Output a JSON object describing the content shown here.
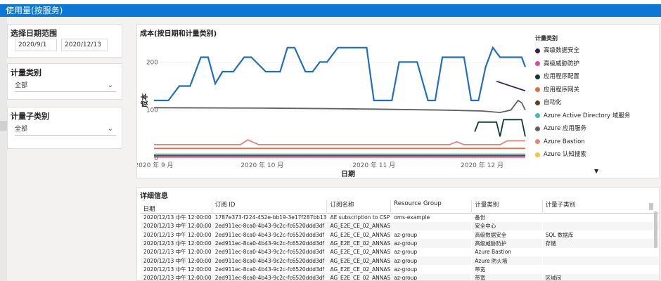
{
  "header": {
    "title": "使用量(按服务)"
  },
  "date_slicer": {
    "title": "选择日期范围",
    "start": "2020/9/1",
    "end": "2020/12/13"
  },
  "meter_category_slicer": {
    "title": "计量类别",
    "value": "全部"
  },
  "meter_subcategory_slicer": {
    "title": "计量子类别",
    "value": "全部"
  },
  "chart": {
    "title": "成本(按日期和计量类别)",
    "ylabel": "成本",
    "xlabel": "日期",
    "yticks": [
      "0",
      "100",
      "200"
    ],
    "xticks": [
      "2020 年 9 月",
      "2020 年 10 月",
      "2020 年 11 月",
      "2020 年 12 月"
    ],
    "legend_title": "计量类别",
    "legend_more_icon": "triangle-down-icon",
    "legend": [
      {
        "name": "高级数据安全",
        "color": "#3b1d4a"
      },
      {
        "name": "高级威胁防护",
        "color": "#e044a7"
      },
      {
        "name": "应用程序配置",
        "color": "#0e3a2f"
      },
      {
        "name": "应用程序网关",
        "color": "#e66c37"
      },
      {
        "name": "自动化",
        "color": "#6b3a1f"
      },
      {
        "name": "Azure Active Directory 域服务",
        "color": "#3cc0b5"
      },
      {
        "name": "Azure 应用服务",
        "color": "#616161"
      },
      {
        "name": "Azure Bastion",
        "color": "#e8817b"
      },
      {
        "name": "Azure 认知搜索",
        "color": "#f5c242"
      }
    ]
  },
  "chart_data": {
    "type": "line",
    "title": "成本(按日期和计量类别)",
    "xlabel": "日期",
    "ylabel": "成本",
    "x_range": [
      "2020-09-01",
      "2020-12-13"
    ],
    "ylim": [
      0,
      240
    ],
    "legend_position": "right",
    "series": [
      {
        "name": "Azure 认知搜索",
        "color": "#1f6fc0",
        "x": [
          "2020-09-01",
          "2020-09-05",
          "2020-09-08",
          "2020-09-11",
          "2020-09-14",
          "2020-09-16",
          "2020-09-18",
          "2020-09-20",
          "2020-09-23",
          "2020-09-26",
          "2020-09-28",
          "2020-10-02",
          "2020-10-06",
          "2020-10-08",
          "2020-10-10",
          "2020-10-13",
          "2020-10-15",
          "2020-10-17",
          "2020-10-19",
          "2020-10-22",
          "2020-10-24",
          "2020-10-30",
          "2020-11-01",
          "2020-11-04",
          "2020-11-06",
          "2020-11-08",
          "2020-11-10",
          "2020-11-13",
          "2020-11-16",
          "2020-11-18",
          "2020-11-20",
          "2020-11-26",
          "2020-11-28",
          "2020-11-30",
          "2020-12-02",
          "2020-12-04",
          "2020-12-06",
          "2020-12-08",
          "2020-12-10",
          "2020-12-12",
          "2020-12-13"
        ],
        "values": [
          120,
          120,
          150,
          150,
          210,
          210,
          155,
          180,
          180,
          210,
          210,
          180,
          180,
          230,
          230,
          180,
          180,
          200,
          200,
          230,
          230,
          230,
          120,
          120,
          120,
          200,
          200,
          200,
          120,
          120,
          210,
          210,
          120,
          120,
          190,
          230,
          210,
          210,
          210,
          210,
          190
        ]
      },
      {
        "name": "Azure 应用服务",
        "color": "#616161",
        "x": [
          "2020-09-01",
          "2020-10-01",
          "2020-10-20",
          "2020-11-01",
          "2020-11-20",
          "2020-12-01",
          "2020-12-06",
          "2020-12-09",
          "2020-12-11",
          "2020-12-12",
          "2020-12-13"
        ],
        "values": [
          105,
          104,
          103,
          102,
          100,
          98,
          95,
          100,
          120,
          115,
          100
        ]
      },
      {
        "name": "高级数据安全",
        "color": "#3b1d4a",
        "x": [
          "2020-12-05",
          "2020-12-13"
        ],
        "values": [
          160,
          140
        ]
      },
      {
        "name": "应用程序配置",
        "color": "#0e3a2f",
        "x": [
          "2020-11-29",
          "2020-11-30",
          "2020-12-01",
          "2020-12-04",
          "2020-12-05",
          "2020-12-06",
          "2020-12-07",
          "2020-12-09",
          "2020-12-12",
          "2020-12-13"
        ],
        "values": [
          55,
          75,
          75,
          75,
          75,
          45,
          80,
          80,
          80,
          45
        ]
      },
      {
        "name": "Azure Bastion",
        "color": "#e8817b",
        "x": [
          "2020-09-01",
          "2020-09-25",
          "2020-09-27",
          "2020-09-30",
          "2020-11-22",
          "2020-11-24",
          "2020-11-26",
          "2020-12-06",
          "2020-12-08",
          "2020-12-13"
        ],
        "values": [
          28,
          28,
          38,
          28,
          28,
          34,
          28,
          28,
          36,
          36
        ]
      },
      {
        "name": "Azure Active Directory 域服务",
        "color": "#3cc0b5",
        "x": [
          "2020-09-01",
          "2020-12-13"
        ],
        "values": [
          8,
          8
        ]
      },
      {
        "name": "高级威胁防护",
        "color": "#e044a7",
        "x": [
          "2020-09-01",
          "2020-12-13"
        ],
        "values": [
          2,
          2
        ]
      },
      {
        "name": "应用程序网关",
        "color": "#e66c37",
        "x": [
          "2020-09-01",
          "2020-12-13"
        ],
        "values": [
          20,
          20
        ]
      },
      {
        "name": "自动化",
        "color": "#6b3a1f",
        "x": [
          "2020-09-01",
          "2020-12-13"
        ],
        "values": [
          5,
          5
        ]
      }
    ]
  },
  "table": {
    "title": "详细信息",
    "columns": [
      "日期",
      "订阅 ID",
      "订阅名称",
      "Resource Group",
      "计量类别",
      "计量子类别"
    ],
    "rows": [
      [
        "2020/12/13 中午 12:00:00",
        "1787e373-f224-452e-bb19-3e17f287bb13",
        "AE subscription to CSP",
        "oms-example",
        "备份",
        ""
      ],
      [
        "2020/12/13 中午 12:00:00",
        "2ed911ec-8ca0-4b43-9c2c-fc6520ddd3df",
        "AG_E2E_CE_02_ANNAS",
        "",
        "安全中心",
        ""
      ],
      [
        "2020/12/13 中午 12:00:00",
        "2ed911ec-8ca0-4b43-9c2c-fc6520ddd3df",
        "AG_E2E_CE_02_ANNAS",
        "az-group",
        "高级数据安全",
        "SQL 数据库"
      ],
      [
        "2020/12/13 中午 12:00:00",
        "2ed911ec-8ca0-4b43-9c2c-fc6520ddd3df",
        "AG_E2E_CE_02_ANNAS",
        "az-group",
        "高级威胁防护",
        "存储"
      ],
      [
        "2020/12/13 中午 12:00:00",
        "2ed911ec-8ca0-4b43-9c2c-fc6520ddd3df",
        "AG_E2E_CE_02_ANNAS",
        "az-group",
        "Azure Bastion",
        ""
      ],
      [
        "2020/12/13 中午 12:00:00",
        "2ed911ec-8ca0-4b43-9c2c-fc6520ddd3df",
        "AG_E2E_CE_02_ANNAS",
        "az-group",
        "Azure 防火墙",
        ""
      ],
      [
        "2020/12/13 中午 12:00:00",
        "2ed911ec-8ca0-4b43-9c2c-fc6520ddd3df",
        "AG_E2E_CE_02_ANNAS",
        "az-group",
        "带宽",
        ""
      ],
      [
        "2020/12/13 中午 12:00:00",
        "2ed911ec-8ca0-4b43-9c2c-fc6520ddd3df",
        "AG_E2E_CE_02_ANNAS",
        "az-group",
        "带宽",
        "区域间"
      ]
    ]
  }
}
